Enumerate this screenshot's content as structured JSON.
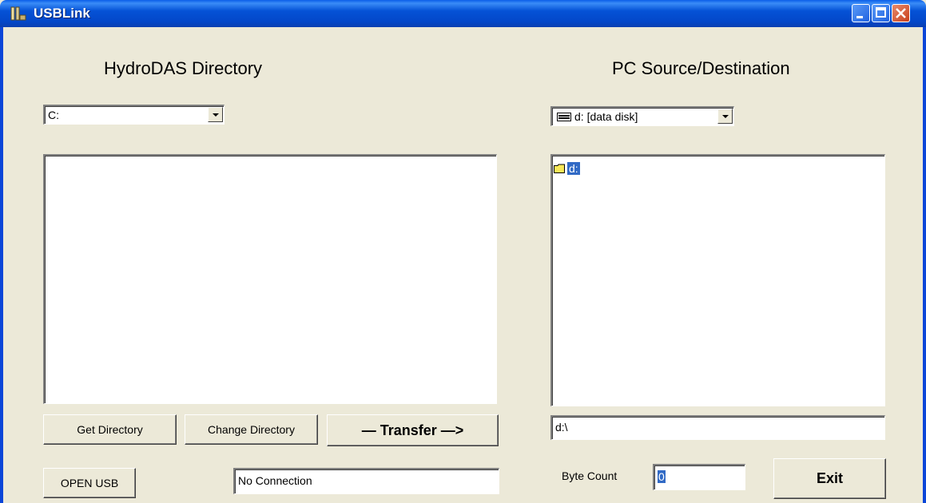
{
  "window": {
    "title": "USBLink"
  },
  "left_panel": {
    "heading": "HydroDAS Directory",
    "drive_combo_value": "C:",
    "buttons": {
      "get_directory": "Get Directory",
      "change_directory": "Change Directory",
      "transfer": "— Transfer —>"
    }
  },
  "right_panel": {
    "heading": "PC Source/Destination",
    "drive_combo_value": "d: [data disk]",
    "tree_items": [
      "d:"
    ],
    "path_value": "d:\\"
  },
  "bottom": {
    "open_usb": "OPEN USB",
    "status_value": "No Connection",
    "byte_count_label": "Byte Count",
    "byte_count_value": "0",
    "exit": "Exit"
  },
  "colors": {
    "titlebar": "#0552d6",
    "window_bg": "#ece9d8",
    "selection": "#316ac5"
  }
}
